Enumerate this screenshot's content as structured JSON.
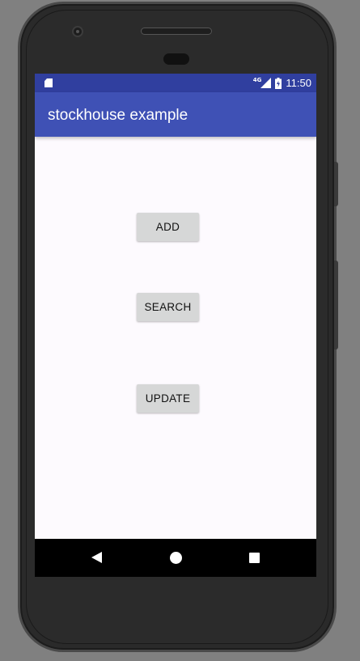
{
  "status_bar": {
    "network_label": "4G",
    "time": "11:50",
    "icons": [
      "sd-card-icon",
      "signal-icon",
      "battery-icon"
    ]
  },
  "app_bar": {
    "title": "stockhouse example"
  },
  "main": {
    "buttons": [
      {
        "label": "ADD"
      },
      {
        "label": "SEARCH"
      },
      {
        "label": "UPDATE"
      }
    ]
  },
  "nav_bar": {
    "icons": [
      "back-icon",
      "home-icon",
      "recent-apps-icon"
    ]
  },
  "colors": {
    "status_bar": "#303f9f",
    "app_bar": "#3f51b5",
    "background": "#fdfafe",
    "button": "#d6d7d7"
  }
}
